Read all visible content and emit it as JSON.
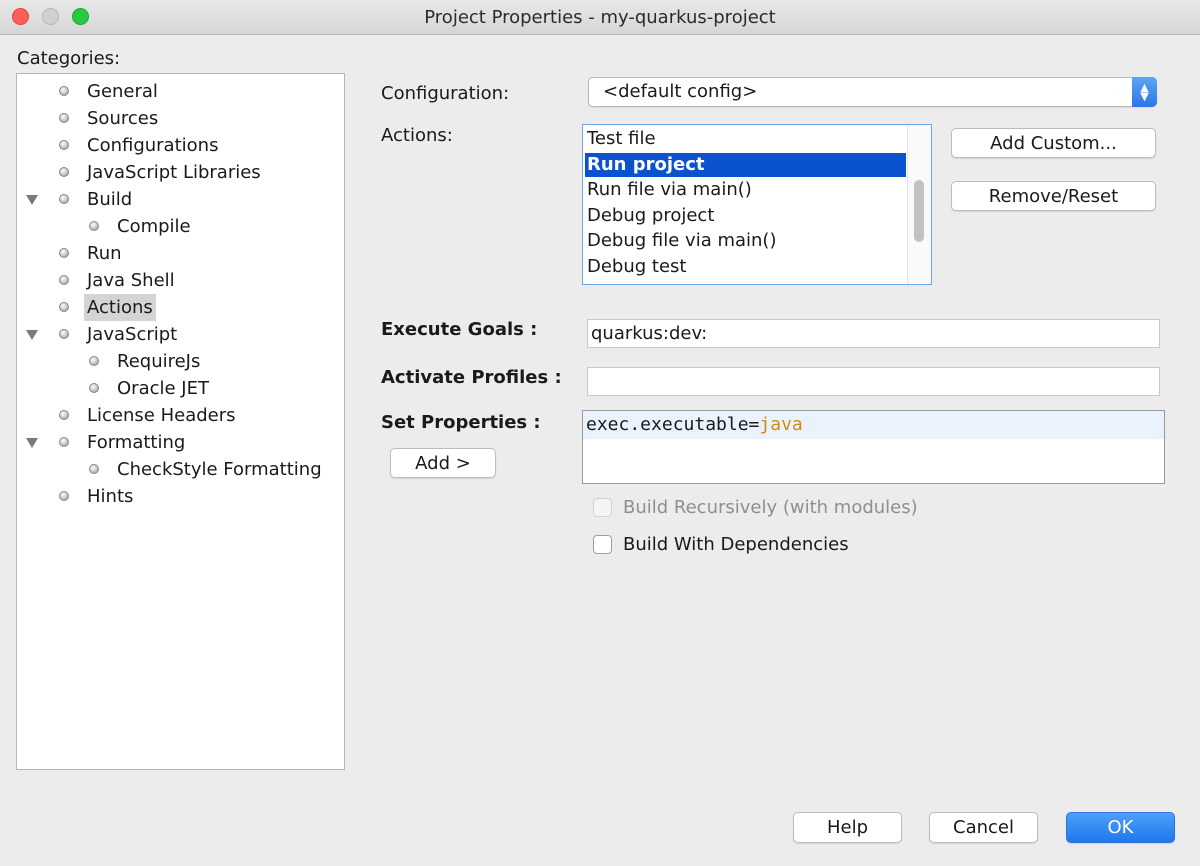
{
  "window": {
    "title": "Project Properties - my-quarkus-project"
  },
  "categories": {
    "label": "Categories:",
    "items": [
      {
        "label": "General"
      },
      {
        "label": "Sources"
      },
      {
        "label": "Configurations"
      },
      {
        "label": "JavaScript Libraries"
      },
      {
        "label": "Build"
      },
      {
        "label": "Compile"
      },
      {
        "label": "Run"
      },
      {
        "label": "Java Shell"
      },
      {
        "label": "Actions"
      },
      {
        "label": "JavaScript"
      },
      {
        "label": "RequireJs"
      },
      {
        "label": "Oracle JET"
      },
      {
        "label": "License Headers"
      },
      {
        "label": "Formatting"
      },
      {
        "label": "CheckStyle Formatting"
      },
      {
        "label": "Hints"
      }
    ],
    "selected": "Actions"
  },
  "configuration": {
    "label": "Configuration:",
    "value": "<default config>"
  },
  "actions": {
    "label": "Actions:",
    "items": [
      "Test file",
      "Run project",
      "Run file via main()",
      "Debug project",
      "Debug file via main()",
      "Debug test"
    ],
    "selected": "Run project",
    "add_custom_label": "Add Custom...",
    "remove_reset_label": "Remove/Reset"
  },
  "execute_goals": {
    "label": "Execute Goals :",
    "value": "quarkus:dev:"
  },
  "activate_profiles": {
    "label": "Activate Profiles :",
    "value": ""
  },
  "set_properties": {
    "label": "Set Properties :",
    "add_label": "Add >",
    "key": "exec.executable=",
    "value": "java",
    "value_color": "#d08a12"
  },
  "options": {
    "build_recursively": {
      "label": "Build Recursively (with modules)",
      "checked": false,
      "enabled": false
    },
    "build_with_dependencies": {
      "label": "Build With Dependencies",
      "checked": false,
      "enabled": true
    }
  },
  "footer": {
    "help_label": "Help",
    "cancel_label": "Cancel",
    "ok_label": "OK"
  },
  "colors": {
    "selection": "#0b52cf",
    "primary_button": "#1f77ec"
  }
}
